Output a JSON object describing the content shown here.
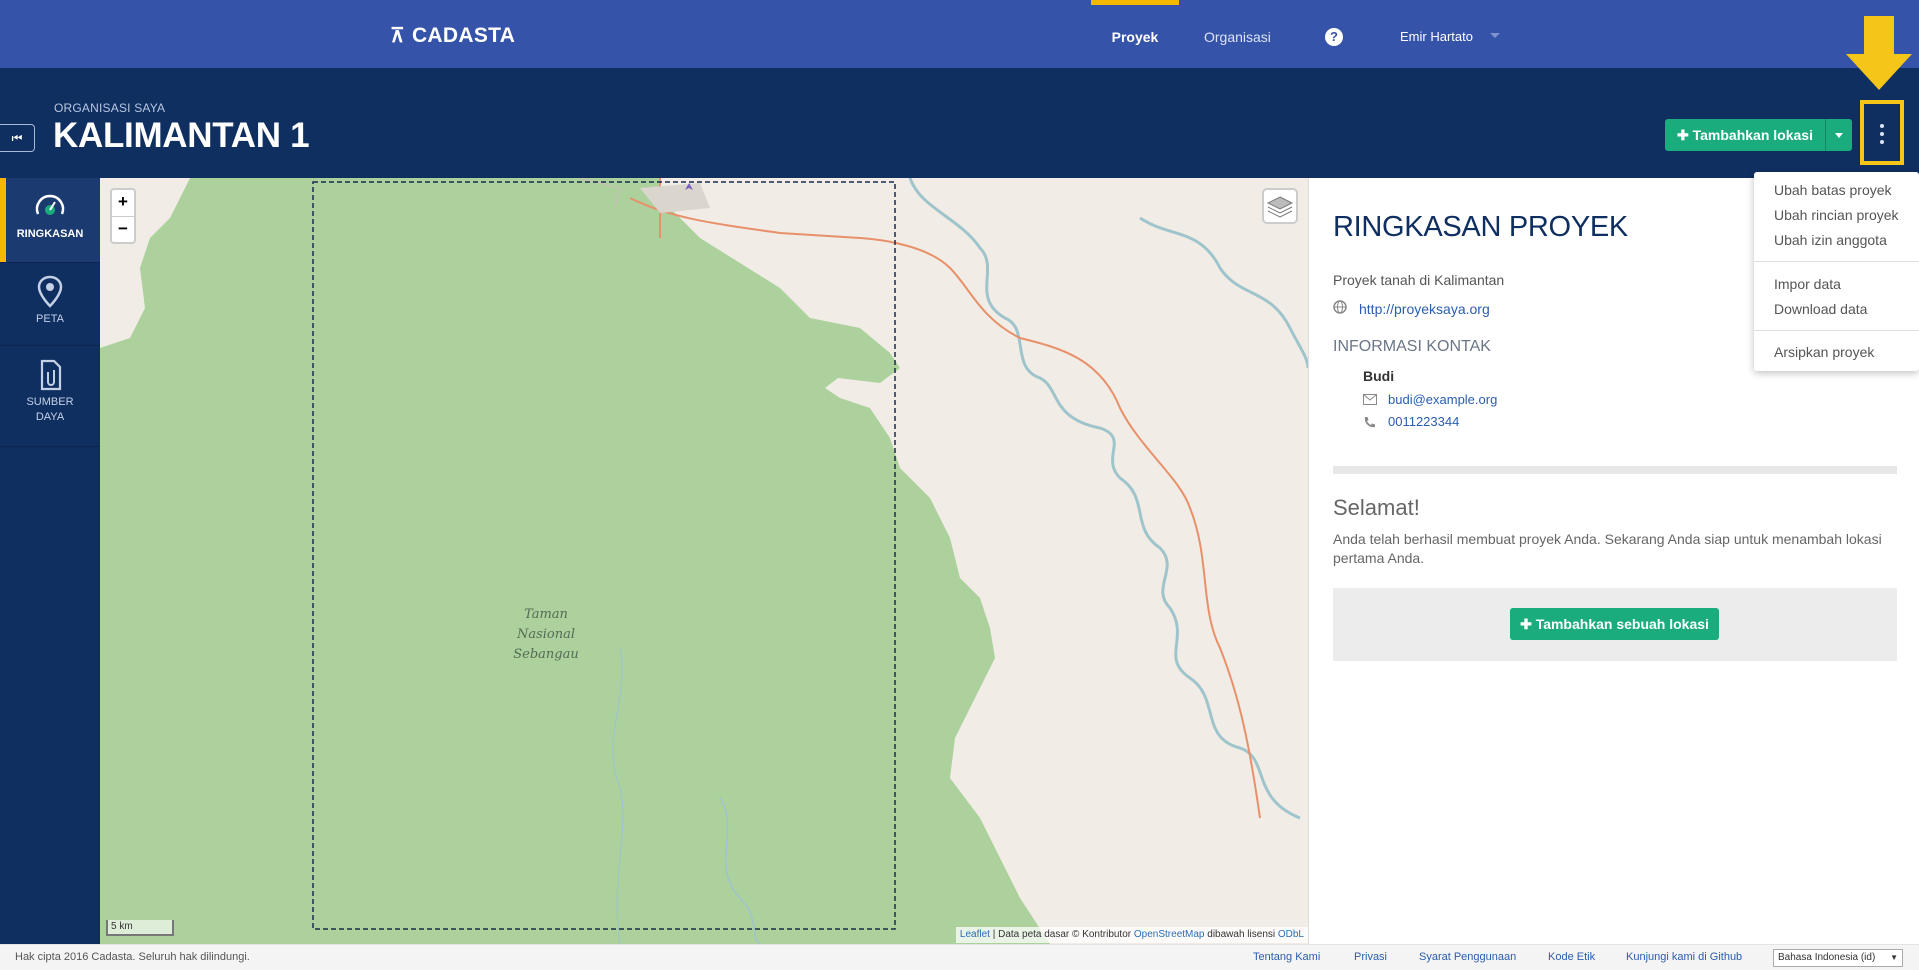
{
  "topnav": {
    "brand": "CADASTA",
    "items": [
      {
        "label": "Proyek",
        "active": true
      },
      {
        "label": "Organisasi",
        "active": false
      }
    ],
    "help_icon": "help-circle-icon",
    "user": "Emir Hartato"
  },
  "header": {
    "org_label": "ORGANISASI SAYA",
    "title": "KALIMANTAN 1",
    "add_location_label": "Tambahkan lokasi",
    "more_icon": "kebab-menu-icon"
  },
  "sidebar": {
    "items": [
      {
        "label_lines": [
          "RINGKASAN"
        ],
        "icon": "dashboard-icon",
        "active": true
      },
      {
        "label_lines": [
          "PETA"
        ],
        "icon": "map-pin-icon",
        "active": false
      },
      {
        "label_lines": [
          "SUMBER",
          "DAYA"
        ],
        "icon": "attachment-file-icon",
        "active": false
      }
    ]
  },
  "map": {
    "zoom_in": "+",
    "zoom_out": "−",
    "park_label": [
      "Taman",
      "Nasional",
      "Sebangau"
    ],
    "scale": "5 km",
    "attribution": {
      "leaflet": "Leaflet",
      "sep": " | Data peta dasar © Kontributor ",
      "osm": "OpenStreetMap",
      "license_text": " dibawah lisensi ",
      "odbl": "ODbL"
    }
  },
  "panel": {
    "title": "RINGKASAN PROYEK",
    "description": "Proyek tanah di Kalimantan",
    "url": "http://proyeksaya.org",
    "contact_heading": "INFORMASI KONTAK",
    "contact_name": "Budi",
    "contact_email": "budi@example.org",
    "contact_phone": "0011223344",
    "congrats_title": "Selamat!",
    "congrats_text": "Anda telah berhasil membuat proyek Anda. Sekarang Anda siap untuk menambah lokasi pertama Anda.",
    "cta_label": "Tambahkan sebuah lokasi"
  },
  "dropdown": {
    "groups": [
      [
        "Ubah batas proyek",
        "Ubah rincian proyek",
        "Ubah izin anggota"
      ],
      [
        "Impor data",
        "Download data"
      ],
      [
        "Arsipkan proyek"
      ]
    ]
  },
  "footer": {
    "copyright": "Hak cipta 2016 Cadasta. Seluruh hak dilindungi.",
    "links": [
      "Tentang Kami",
      "Privasi",
      "Syarat Penggunaan",
      "Kode Etik",
      "Kunjungi kami di Github"
    ],
    "language": "Bahasa Indonesia (id)"
  },
  "colors": {
    "nav_blue": "#3553a8",
    "header_navy": "#102f61",
    "accent_yellow": "#f5b800",
    "primary_green": "#1aac7c",
    "park_green": "#acd19c"
  }
}
